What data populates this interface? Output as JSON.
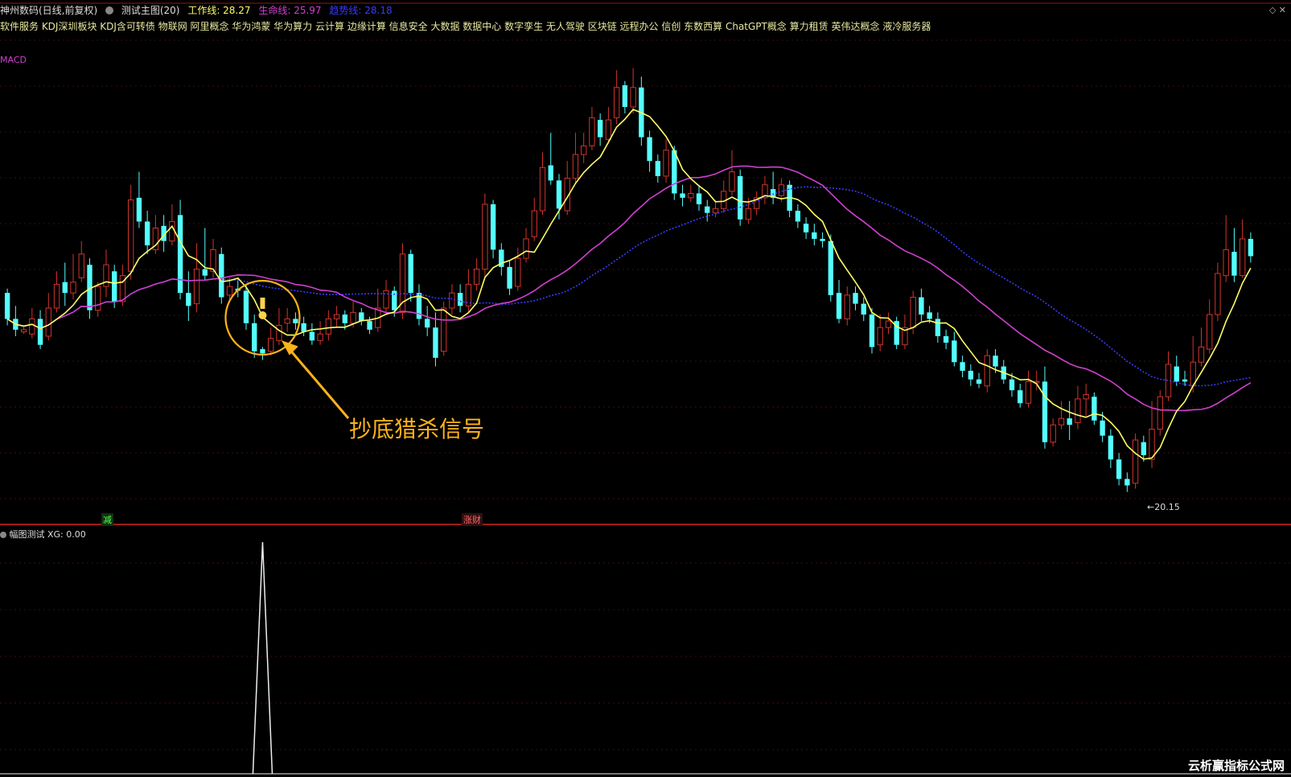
{
  "header": {
    "stock": "神州数码(日线,前复权)",
    "indicator": "测试主图(20)",
    "work_line": "工作线: 28.27",
    "life_line": "生命线: 25.97",
    "trend_line": "趋势线: 28.18"
  },
  "concepts": "软件服务 KDJ深圳板块 KDJ含可转债 物联网 阿里概念 华为鸿蒙 华为算力 云计算 边缘计算 信息安全 大数据 数据中心 数字孪生 无人驾驶 区块链 远程办公 信创 东数西算 ChatGPT概念 算力租赁 英伟达概念 液冷服务器",
  "macd_label": "MACD",
  "annotation": "抄底猎杀信号",
  "low_label": "←20.15",
  "tags": {
    "jian": "减",
    "zhangcai": "涨财"
  },
  "sub_panel": {
    "title": "幅图测试",
    "value": "XG: 0.00"
  },
  "watermark": "云析赢指标公式网",
  "colors": {
    "up": "#d2342c",
    "down": "#54ffff",
    "work_line": "#ffff66",
    "life_line": "#d040d0",
    "trend_line": "#3a3aff",
    "annotation": "#ffb31a"
  },
  "icons": {
    "corner": [
      "diamond-icon",
      "close-icon"
    ]
  },
  "chart_data": {
    "type": "candlestick",
    "y_low_marked": 20.15,
    "candles": [
      [
        29.2,
        28.0,
        29.4,
        27.7
      ],
      [
        28.0,
        27.5,
        28.6,
        27.2
      ],
      [
        27.4,
        27.5,
        27.7,
        27.3
      ],
      [
        27.3,
        28.0,
        28.5,
        27.1
      ],
      [
        28.0,
        26.8,
        28.4,
        26.6
      ],
      [
        27.2,
        28.5,
        29.2,
        27.0
      ],
      [
        28.5,
        29.6,
        30.2,
        28.3
      ],
      [
        29.7,
        29.2,
        30.6,
        28.6
      ],
      [
        29.2,
        29.7,
        31.0,
        28.9
      ],
      [
        29.9,
        31.0,
        31.6,
        29.7
      ],
      [
        30.5,
        28.4,
        30.8,
        28.0
      ],
      [
        28.4,
        29.5,
        29.7,
        28.1
      ],
      [
        29.5,
        30.5,
        31.2,
        29.0
      ],
      [
        30.2,
        28.8,
        30.5,
        28.5
      ],
      [
        28.8,
        30.0,
        30.5,
        28.6
      ],
      [
        30.2,
        33.5,
        34.2,
        29.8
      ],
      [
        33.6,
        32.5,
        34.8,
        32.2
      ],
      [
        32.5,
        31.4,
        33.0,
        31.0
      ],
      [
        31.2,
        32.2,
        32.8,
        31.0
      ],
      [
        32.3,
        31.6,
        32.8,
        31.1
      ],
      [
        31.6,
        32.5,
        33.3,
        31.4
      ],
      [
        32.8,
        29.2,
        33.5,
        28.9
      ],
      [
        29.2,
        28.6,
        30.2,
        27.9
      ],
      [
        28.7,
        30.3,
        31.5,
        28.3
      ],
      [
        30.3,
        30.0,
        32.2,
        29.8
      ],
      [
        30.2,
        31.2,
        31.7,
        29.9
      ],
      [
        31.0,
        29.0,
        31.3,
        28.7
      ],
      [
        29.1,
        29.5,
        29.9,
        28.8
      ],
      [
        29.4,
        29.3,
        29.9,
        29.0
      ],
      [
        29.3,
        27.8,
        29.6,
        27.5
      ],
      [
        27.8,
        26.5,
        28.2,
        26.2
      ],
      [
        26.6,
        26.4,
        26.7,
        26.1
      ],
      [
        26.5,
        27.1,
        27.6,
        26.3
      ],
      [
        27.0,
        27.7,
        28.5,
        26.8
      ],
      [
        27.8,
        28.0,
        28.5,
        27.4
      ],
      [
        28.0,
        27.8,
        28.3,
        27.5
      ],
      [
        27.8,
        27.4,
        28.1,
        27.2
      ],
      [
        27.4,
        27.0,
        27.8,
        26.8
      ],
      [
        27.0,
        27.3,
        27.9,
        26.8
      ],
      [
        27.3,
        28.0,
        28.4,
        27.0
      ],
      [
        28.0,
        28.2,
        28.6,
        27.6
      ],
      [
        28.2,
        27.8,
        28.4,
        27.5
      ],
      [
        27.8,
        28.3,
        28.8,
        27.6
      ],
      [
        28.3,
        27.9,
        28.5,
        27.7
      ],
      [
        27.9,
        27.5,
        28.1,
        27.3
      ],
      [
        27.6,
        28.5,
        29.4,
        27.4
      ],
      [
        28.5,
        29.3,
        29.8,
        28.2
      ],
      [
        29.3,
        28.4,
        29.5,
        28.1
      ],
      [
        28.3,
        31.0,
        31.5,
        28.0
      ],
      [
        31.0,
        29.2,
        31.2,
        28.8
      ],
      [
        29.2,
        28.0,
        29.6,
        27.7
      ],
      [
        28.0,
        27.6,
        28.6,
        27.2
      ],
      [
        27.6,
        26.2,
        28.3,
        25.8
      ],
      [
        26.5,
        28.5,
        28.8,
        26.3
      ],
      [
        28.5,
        29.2,
        29.6,
        28.2
      ],
      [
        29.2,
        28.6,
        29.6,
        28.3
      ],
      [
        28.6,
        29.6,
        30.3,
        28.3
      ],
      [
        29.6,
        30.3,
        30.8,
        29.3
      ],
      [
        30.3,
        33.3,
        33.8,
        29.9
      ],
      [
        33.3,
        31.2,
        33.5,
        30.8
      ],
      [
        31.2,
        30.4,
        31.5,
        30.0
      ],
      [
        30.4,
        29.4,
        30.7,
        29.1
      ],
      [
        29.5,
        30.8,
        31.3,
        29.3
      ],
      [
        30.8,
        31.7,
        32.2,
        30.6
      ],
      [
        31.8,
        33.0,
        33.6,
        31.6
      ],
      [
        33.0,
        35.0,
        35.7,
        32.8
      ],
      [
        35.1,
        34.4,
        36.6,
        34.2
      ],
      [
        34.4,
        33.1,
        34.7,
        32.6
      ],
      [
        33.0,
        34.5,
        35.3,
        32.8
      ],
      [
        34.5,
        35.6,
        36.6,
        34.3
      ],
      [
        35.6,
        36.0,
        36.6,
        35.2
      ],
      [
        36.0,
        37.3,
        37.8,
        35.8
      ],
      [
        37.2,
        36.4,
        37.5,
        36.0
      ],
      [
        36.3,
        37.2,
        37.8,
        36.1
      ],
      [
        37.3,
        38.7,
        39.5,
        37.0
      ],
      [
        38.8,
        37.8,
        39.0,
        37.5
      ],
      [
        37.8,
        38.7,
        39.6,
        37.5
      ],
      [
        38.7,
        36.4,
        39.2,
        36.0
      ],
      [
        36.4,
        35.3,
        36.7,
        34.8
      ],
      [
        35.3,
        34.6,
        35.6,
        34.3
      ],
      [
        34.6,
        35.8,
        36.3,
        34.3
      ],
      [
        35.8,
        33.8,
        36.0,
        33.5
      ],
      [
        33.8,
        33.6,
        34.2,
        33.2
      ],
      [
        33.6,
        33.8,
        34.2,
        33.4
      ],
      [
        33.8,
        33.3,
        34.2,
        33.0
      ],
      [
        33.2,
        32.9,
        33.5,
        32.5
      ],
      [
        32.9,
        33.1,
        33.5,
        32.7
      ],
      [
        33.1,
        33.9,
        34.4,
        32.9
      ],
      [
        33.9,
        34.8,
        35.8,
        33.7
      ],
      [
        34.6,
        32.6,
        34.9,
        32.3
      ],
      [
        32.6,
        33.1,
        33.6,
        32.4
      ],
      [
        33.1,
        33.6,
        33.9,
        32.8
      ],
      [
        33.6,
        34.2,
        34.6,
        33.3
      ],
      [
        34.0,
        33.6,
        34.8,
        33.3
      ],
      [
        33.7,
        34.2,
        34.5,
        33.4
      ],
      [
        34.2,
        33.0,
        34.4,
        32.7
      ],
      [
        33.0,
        32.5,
        33.3,
        32.2
      ],
      [
        32.4,
        32.0,
        32.7,
        31.7
      ],
      [
        32.0,
        31.7,
        32.4,
        31.4
      ],
      [
        31.7,
        31.6,
        32.0,
        31.3
      ],
      [
        31.6,
        29.1,
        31.9,
        28.8
      ],
      [
        29.2,
        28.0,
        29.8,
        27.8
      ],
      [
        28.0,
        29.1,
        29.5,
        27.7
      ],
      [
        29.2,
        28.7,
        29.5,
        28.4
      ],
      [
        28.7,
        28.2,
        29.0,
        27.9
      ],
      [
        28.2,
        26.7,
        28.5,
        26.4
      ],
      [
        26.8,
        27.6,
        28.2,
        26.5
      ],
      [
        27.6,
        27.9,
        28.3,
        27.3
      ],
      [
        27.9,
        26.8,
        28.1,
        26.6
      ],
      [
        26.8,
        27.6,
        28.2,
        26.6
      ],
      [
        27.6,
        29.0,
        29.3,
        27.3
      ],
      [
        29.0,
        28.2,
        29.4,
        27.9
      ],
      [
        28.3,
        28.0,
        28.6,
        27.8
      ],
      [
        28.0,
        27.2,
        28.3,
        26.9
      ],
      [
        27.2,
        26.9,
        27.5,
        26.6
      ],
      [
        27.0,
        26.0,
        27.4,
        25.8
      ],
      [
        26.0,
        25.6,
        26.3,
        25.3
      ],
      [
        25.6,
        25.2,
        25.9,
        24.9
      ],
      [
        25.2,
        25.0,
        25.5,
        24.8
      ],
      [
        24.9,
        26.3,
        26.6,
        24.6
      ],
      [
        26.3,
        25.8,
        26.6,
        25.5
      ],
      [
        25.8,
        25.2,
        26.1,
        25.0
      ],
      [
        25.2,
        24.7,
        25.5,
        24.4
      ],
      [
        24.7,
        24.1,
        25.0,
        23.9
      ],
      [
        24.1,
        25.1,
        25.6,
        23.9
      ],
      [
        25.1,
        25.1,
        25.6,
        24.7
      ],
      [
        25.1,
        22.3,
        25.8,
        22.0
      ],
      [
        22.3,
        23.1,
        23.4,
        22.1
      ],
      [
        23.1,
        23.4,
        24.2,
        22.9
      ],
      [
        23.4,
        23.1,
        24.2,
        22.4
      ],
      [
        23.2,
        24.3,
        24.9,
        22.9
      ],
      [
        24.3,
        24.5,
        25.0,
        23.5
      ],
      [
        24.4,
        23.3,
        24.6,
        23.1
      ],
      [
        23.3,
        22.6,
        23.7,
        22.3
      ],
      [
        22.6,
        21.5,
        22.9,
        21.1
      ],
      [
        21.5,
        20.6,
        21.8,
        20.3
      ],
      [
        20.6,
        20.3,
        20.9,
        20.0
      ],
      [
        20.4,
        22.4,
        22.7,
        20.15
      ],
      [
        22.3,
        21.7,
        22.6,
        21.4
      ],
      [
        21.5,
        22.9,
        24.2,
        21.1
      ],
      [
        22.9,
        24.4,
        24.7,
        22.6
      ],
      [
        24.4,
        25.9,
        26.5,
        24.2
      ],
      [
        25.8,
        25.1,
        26.3,
        24.9
      ],
      [
        25.2,
        25.1,
        25.6,
        24.9
      ],
      [
        24.9,
        26.0,
        27.2,
        24.6
      ],
      [
        26.0,
        26.7,
        27.6,
        25.8
      ],
      [
        26.6,
        28.2,
        28.9,
        26.4
      ],
      [
        28.2,
        30.1,
        30.6,
        27.9
      ],
      [
        30.0,
        31.2,
        32.8,
        29.7
      ],
      [
        31.1,
        30.0,
        32.2,
        29.7
      ],
      [
        30.0,
        31.7,
        32.6,
        29.9
      ],
      [
        31.7,
        30.9,
        32.0,
        30.6
      ]
    ],
    "signal_index": 31,
    "sub_series": "XG spike = 1 at signal candle, 0 elsewhere"
  }
}
